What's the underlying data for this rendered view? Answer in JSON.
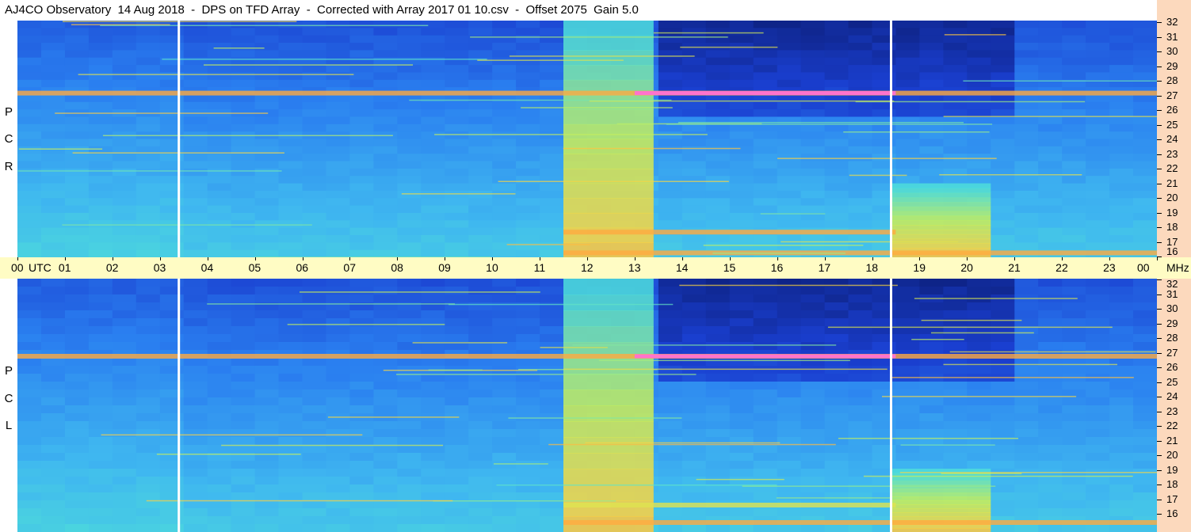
{
  "title": "AJ4CO Observatory  14 Aug 2018  -  DPS on TFD Array  -  Corrected with Array 2017 01 10.csv  -  Offset 2075  Gain 5.0",
  "polarization_labels": {
    "top": [
      "R",
      "C",
      "P"
    ],
    "bottom": [
      "L",
      "C",
      "P"
    ]
  },
  "time_axis": {
    "ticks": [
      "00",
      "01",
      "02",
      "03",
      "04",
      "05",
      "06",
      "07",
      "08",
      "09",
      "10",
      "11",
      "12",
      "13",
      "14",
      "15",
      "16",
      "17",
      "18",
      "19",
      "20",
      "21",
      "22",
      "23",
      "00"
    ],
    "utc_label": "UTC",
    "mhz_label": "MHz"
  },
  "freq_axis_labels": [
    "32",
    "31",
    "30",
    "29",
    "28",
    "27",
    "26",
    "25",
    "24",
    "23",
    "22",
    "21",
    "20",
    "19",
    "18",
    "17",
    "16"
  ],
  "colors": {
    "axis_background": "#fffcc4",
    "freq_axis_background": "#fcd9bd",
    "gap_line": "#ffffff",
    "colormap": [
      "#0a1a6e",
      "#1a3fd0",
      "#2a7ff0",
      "#3fb7f0",
      "#4fe0d8",
      "#c8f05a",
      "#ffd040",
      "#ff8040",
      "#ff20b0",
      "#ffffff"
    ]
  },
  "chart_data": {
    "type": "heatmap",
    "title": "AJ4CO Observatory  14 Aug 2018  -  DPS on TFD Array  -  Corrected with Array 2017 01 10.csv  -  Offset 2075  Gain 5.0",
    "xlabel": "UTC",
    "ylabel": "MHz",
    "x_range_utc_hours": [
      0,
      24
    ],
    "y_range_mhz": [
      16,
      32
    ],
    "panels": [
      {
        "name": "RCP",
        "data_gaps_utc": [
          3.4,
          18.4
        ],
        "bright_bands": [
          {
            "freq_mhz": 27.1,
            "from_utc": 0.0,
            "to_utc": 24.0,
            "peak_level": "high",
            "peak_from_utc": 13.0,
            "peak_to_utc": 18.5
          },
          {
            "freq_mhz": 17.7,
            "from_utc": 11.5,
            "to_utc": 18.5,
            "peak_level": "high"
          },
          {
            "freq_mhz": 16.3,
            "from_utc": 11.5,
            "to_utc": 24.0,
            "peak_level": "high"
          }
        ],
        "enhanced_blocks": [
          {
            "from_utc": 11.5,
            "to_utc": 13.4,
            "from_mhz": 16,
            "to_mhz": 32
          },
          {
            "from_utc": 18.4,
            "to_utc": 20.5,
            "from_mhz": 16,
            "to_mhz": 21
          }
        ]
      },
      {
        "name": "LCP",
        "data_gaps_utc": [
          3.4,
          18.4
        ],
        "bright_bands": [
          {
            "freq_mhz": 27.1,
            "from_utc": 0.0,
            "to_utc": 24.0,
            "peak_level": "high",
            "peak_from_utc": 13.0,
            "peak_to_utc": 18.5
          },
          {
            "freq_mhz": 17.7,
            "from_utc": 11.5,
            "to_utc": 18.5,
            "peak_level": "medium"
          },
          {
            "freq_mhz": 16.6,
            "from_utc": 11.5,
            "to_utc": 24.0,
            "peak_level": "high"
          }
        ],
        "enhanced_blocks": [
          {
            "from_utc": 11.5,
            "to_utc": 13.4,
            "from_mhz": 16,
            "to_mhz": 32
          },
          {
            "from_utc": 18.4,
            "to_utc": 20.5,
            "from_mhz": 16,
            "to_mhz": 20
          }
        ]
      }
    ],
    "grid": false,
    "legend": "none"
  }
}
